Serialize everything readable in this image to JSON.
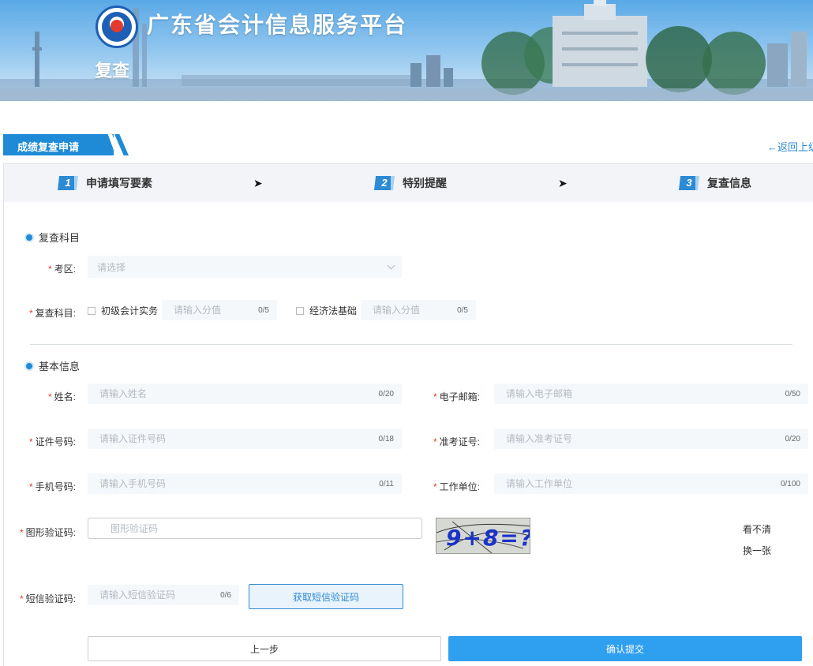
{
  "header": {
    "site_title": "广东省会计信息服务平台",
    "page_label": "复查"
  },
  "section": {
    "tab_label": "成绩复查申请",
    "back_link": "←返回上级"
  },
  "steps": [
    {
      "num": "1",
      "label": "申请填写要素"
    },
    {
      "num": "2",
      "label": "特别提醒"
    },
    {
      "num": "3",
      "label": "复查信息"
    }
  ],
  "step_arrow": "➤",
  "groups": {
    "subjects_title": "复查科目",
    "basic_title": "基本信息"
  },
  "fields": {
    "region": {
      "label": "考区:",
      "placeholder": "请选择"
    },
    "subjects": {
      "label": "复查科目:",
      "items": [
        {
          "name": "初级会计实务",
          "placeholder": "请输入分值",
          "count": "0/5"
        },
        {
          "name": "经济法基础",
          "placeholder": "请输入分值",
          "count": "0/5"
        }
      ]
    },
    "name": {
      "label": "姓名:",
      "placeholder": "请输入姓名",
      "count": "0/20"
    },
    "email": {
      "label": "电子邮箱:",
      "placeholder": "请输入电子邮箱",
      "count": "0/50"
    },
    "id_number": {
      "label": "证件号码:",
      "placeholder": "请输入证件号码",
      "count": "0/18"
    },
    "exam_number": {
      "label": "准考证号:",
      "placeholder": "请输入准考证号",
      "count": "0/20"
    },
    "phone": {
      "label": "手机号码:",
      "placeholder": "请输入手机号码",
      "count": "0/11"
    },
    "employer": {
      "label": "工作单位:",
      "placeholder": "请输入工作单位",
      "count": "0/100"
    },
    "captcha": {
      "label": "图形验证码:",
      "placeholder": "图形验证码",
      "image_text": "9+8=?",
      "refresh_line1": "看不清",
      "refresh_line2": "换一张"
    },
    "sms": {
      "label": "短信验证码:",
      "placeholder": "请输入短信验证码",
      "count": "0/6",
      "button": "获取短信验证码"
    }
  },
  "required_mark": "*",
  "buttons": {
    "prev": "上一步",
    "submit": "确认提交"
  },
  "colors": {
    "primary": "#2f9ff0",
    "accent": "#1f8bd6",
    "required": "#e23a2f"
  }
}
